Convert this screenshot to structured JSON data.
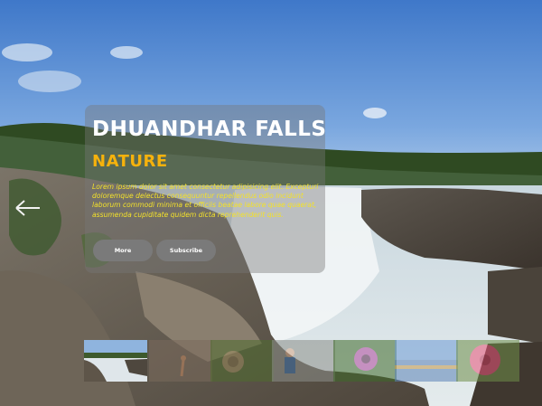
{
  "hero": {
    "title": "DHUANDHAR FALLS",
    "subtitle": "NATURE",
    "description": "Lorem ipsum dolor sit amet consectetur adipisicing elit. Excepturi doloremque delectus consequuntur repellendus odio incidunt laborum commodi minima et officiis beatae labore quae quaerat, assumenda cupiditate quidem dicta reprehenderit quis.",
    "buttons": {
      "more": "More",
      "subscribe": "Subscribe"
    }
  },
  "colors": {
    "title": "#ffffff",
    "subtitle": "#f6b20c",
    "description": "#f3e12a",
    "button_bg": "#7a7a7a"
  },
  "icons": {
    "prev": "arrow-left-icon"
  },
  "thumbnails": [
    {
      "name": "waterfall-thumbnail",
      "active": true
    },
    {
      "name": "rock-thumbnail",
      "active": false
    },
    {
      "name": "snail-thumbnail",
      "active": false
    },
    {
      "name": "person-thumbnail",
      "active": false
    },
    {
      "name": "flower-thumbnail",
      "active": false
    },
    {
      "name": "lake-thumbnail",
      "active": false
    },
    {
      "name": "pink-flower-thumbnail",
      "active": false
    }
  ]
}
